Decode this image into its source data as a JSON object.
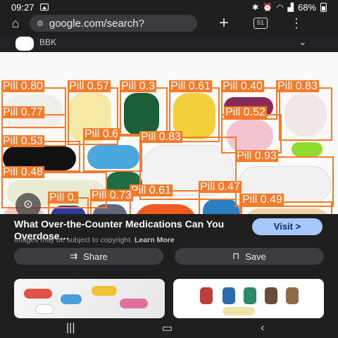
{
  "status_bar": {
    "time": "09:27",
    "battery": "68%"
  },
  "browser": {
    "url": "google.com/search?",
    "tab_count": "51"
  },
  "site": {
    "name": "BBK"
  },
  "detections": [
    {
      "label": "Pill 0.80"
    },
    {
      "label": "Pill 0.57"
    },
    {
      "label": "Pill 0.3"
    },
    {
      "label": "Pill 0.61"
    },
    {
      "label": "Pill 0.40"
    },
    {
      "label": "Pill 0.83"
    },
    {
      "label": "Pill 0.77"
    },
    {
      "label": "Pill 0.52"
    },
    {
      "label": "Pill 0.53"
    },
    {
      "label": "Pill 0.6"
    },
    {
      "label": "Pill 0.83"
    },
    {
      "label": "Pill 0.93"
    },
    {
      "label": "Pill 0.48"
    },
    {
      "label": "Pill 0.61"
    },
    {
      "label": "Pill 0.47"
    },
    {
      "label": "Pill 0."
    },
    {
      "label": "Pill 0.73"
    },
    {
      "label": "Pill 0.49"
    }
  ],
  "result": {
    "title": "What Over-the-Counter Medications Can You Overdose…",
    "copyright_note": "Images may be subject to copyright.",
    "learn_more": "Learn More",
    "visit_label": "Visit >",
    "share_label": "Share",
    "save_label": "Save"
  },
  "colors": {
    "detection_box": "#f47a2c",
    "visit_button": "#a8c7fa",
    "background": "#1f1f1f"
  }
}
